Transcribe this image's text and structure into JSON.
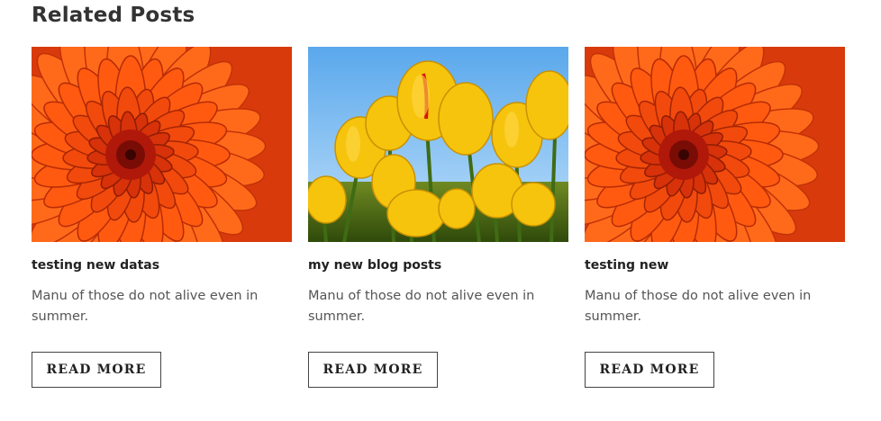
{
  "section": {
    "title": "Related Posts"
  },
  "posts": [
    {
      "title": "testing new datas",
      "excerpt": "Manu of those do not alive even in summer.",
      "button": "READ MORE",
      "image": "orange-chrysanthemum"
    },
    {
      "title": "my new blog posts",
      "excerpt": "Manu of those do not alive even in summer.",
      "button": "READ MORE",
      "image": "yellow-tulips"
    },
    {
      "title": "testing new",
      "excerpt": "Manu of those do not alive even in summer.",
      "button": "READ MORE",
      "image": "orange-chrysanthemum"
    }
  ]
}
